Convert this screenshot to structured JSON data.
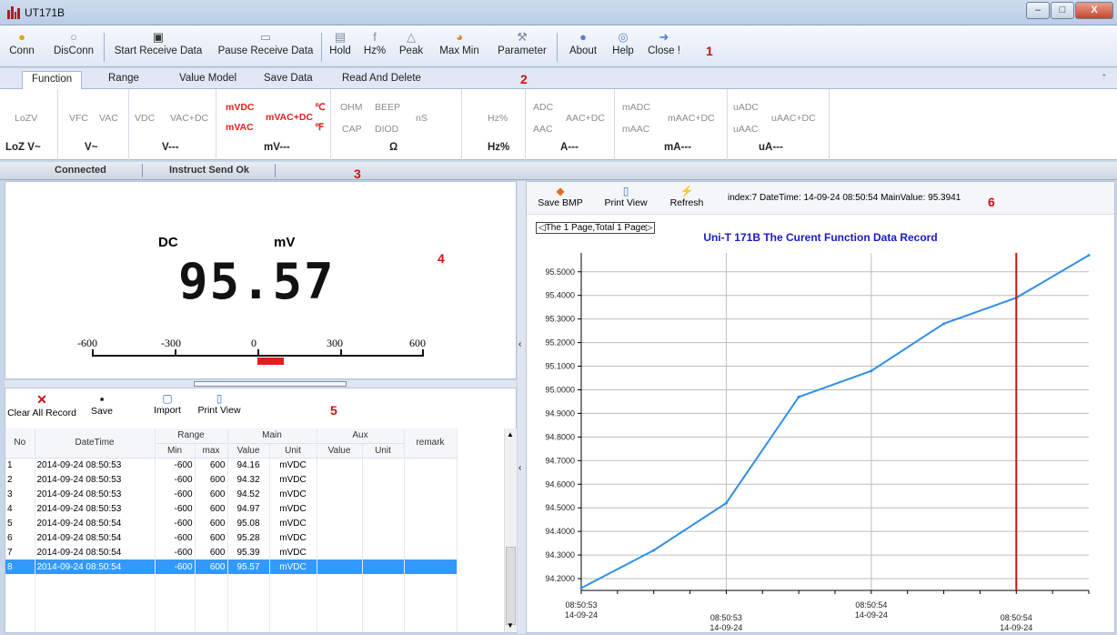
{
  "window": {
    "title": "UT171B",
    "minimize": "–",
    "maximize": "□",
    "close": "X"
  },
  "toolbar": {
    "items": [
      {
        "label": "Conn",
        "icon": "connect-icon"
      },
      {
        "label": "DisConn",
        "icon": "disconnect-icon"
      },
      {
        "label": "Start Receive Data",
        "icon": "start-icon"
      },
      {
        "label": "Pause Receive Data",
        "icon": "pause-icon"
      },
      {
        "label": "Hold",
        "icon": "hold-icon"
      },
      {
        "label": "Hz%",
        "icon": "hz-icon"
      },
      {
        "label": "Peak",
        "icon": "peak-icon"
      },
      {
        "label": "Max Min",
        "icon": "maxmin-icon"
      },
      {
        "label": "Parameter",
        "icon": "parameter-icon"
      },
      {
        "label": "About",
        "icon": "about-icon"
      },
      {
        "label": "Help",
        "icon": "help-icon"
      },
      {
        "label": "Close !",
        "icon": "close-app-icon"
      }
    ]
  },
  "markers": {
    "m1": "1",
    "m2": "2",
    "m3": "3",
    "m4": "4",
    "m5": "5",
    "m6": "6"
  },
  "tabs": [
    "Function",
    "Range",
    "Value Model",
    "Save Data",
    "Read And Delete"
  ],
  "functions": {
    "loz": {
      "top": "LoZV",
      "bottom": "LoZ V~"
    },
    "v": {
      "a": "VFC",
      "b": "VAC",
      "bottom": "V~"
    },
    "vdc": {
      "a": "VDC",
      "b": "VAC+DC",
      "bottom": "V---"
    },
    "mv": {
      "a": "mVDC",
      "b": "mVAC",
      "c": "mVAC+DC",
      "d": "℃",
      "e": "℉",
      "bottom": "mV---"
    },
    "ohm": {
      "a": "OHM",
      "b": "BEEP",
      "c": "CAP",
      "d": "DIOD",
      "e": "nS",
      "bottom": "Ω"
    },
    "hz": {
      "a": "Hz%",
      "bottom": "Hz%"
    },
    "a": {
      "a": "ADC",
      "b": "AAC",
      "c": "AAC+DC",
      "bottom": "A---"
    },
    "ma": {
      "a": "mADC",
      "b": "mAAC",
      "c": "mAAC+DC",
      "bottom": "mA---"
    },
    "ua": {
      "a": "uADC",
      "b": "uAAC",
      "c": "uAAC+DC",
      "bottom": "uA---"
    }
  },
  "status": {
    "conn": "Connected",
    "instr": "Instruct Send Ok"
  },
  "meter": {
    "mode": "DC",
    "unit": "mV",
    "value": "95.57",
    "scale": [
      "-600",
      "-300",
      "0",
      "300",
      "600"
    ],
    "bar_fraction": 0.08
  },
  "records_toolbar": {
    "clear": "Clear All Record",
    "save": "Save",
    "import": "Import",
    "print": "Print View"
  },
  "table": {
    "headers": {
      "no": "No",
      "datetime": "DateTime",
      "range": "Range",
      "main": "Main",
      "aux": "Aux",
      "remark": "remark",
      "min": "Min",
      "max": "max",
      "value": "Value",
      "unit": "Unit",
      "aux_value": "Value",
      "aux_unit": "Unit"
    },
    "rows": [
      [
        "1",
        "2014-09-24 08:50:53",
        "-600",
        "600",
        "94.16",
        "mVDC"
      ],
      [
        "2",
        "2014-09-24 08:50:53",
        "-600",
        "600",
        "94.32",
        "mVDC"
      ],
      [
        "3",
        "2014-09-24 08:50:53",
        "-600",
        "600",
        "94.52",
        "mVDC"
      ],
      [
        "4",
        "2014-09-24 08:50:53",
        "-600",
        "600",
        "94.97",
        "mVDC"
      ],
      [
        "5",
        "2014-09-24 08:50:54",
        "-600",
        "600",
        "95.08",
        "mVDC"
      ],
      [
        "6",
        "2014-09-24 08:50:54",
        "-600",
        "600",
        "95.28",
        "mVDC"
      ],
      [
        "7",
        "2014-09-24 08:50:54",
        "-600",
        "600",
        "95.39",
        "mVDC"
      ],
      [
        "8",
        "2014-09-24 08:50:54",
        "-600",
        "600",
        "95.57",
        "mVDC"
      ]
    ],
    "selected_row": 7
  },
  "chart_toolbar": {
    "save": "Save BMP",
    "print": "Print View",
    "refresh": "Refresh",
    "info": "index:7 DateTime:  14-09-24 08:50:54  MainValue: 95.3941"
  },
  "chart_nav": "◁The 1 Page,Total 1 Page▷",
  "chart_data": {
    "type": "line",
    "title": "Uni-T 171B The Curent Function Data Record",
    "series": [
      {
        "values": [
          94.16,
          94.32,
          94.52,
          94.97,
          95.08,
          95.28,
          95.39,
          95.57
        ]
      }
    ],
    "x": [
      0,
      1,
      2,
      3,
      4,
      5,
      6,
      7
    ],
    "ylim": [
      94.15,
      95.58
    ],
    "yticks": [
      "95.5000",
      "95.4000",
      "95.3000",
      "95.2000",
      "95.1000",
      "95.0000",
      "94.9000",
      "94.8000",
      "94.7000",
      "94.6000",
      "94.5000",
      "94.4000",
      "94.3000",
      "94.2000"
    ],
    "ytick_values": [
      95.5,
      95.4,
      95.3,
      95.2,
      95.1,
      95.0,
      94.9,
      94.8,
      94.7,
      94.6,
      94.5,
      94.4,
      94.3,
      94.2
    ],
    "xticks": [
      {
        "x": 0,
        "time": "08:50:53",
        "date": "14-09-24",
        "row": 0
      },
      {
        "x": 2,
        "time": "08:50:53",
        "date": "14-09-24",
        "row": 1
      },
      {
        "x": 4,
        "time": "08:50:54",
        "date": "14-09-24",
        "row": 0
      },
      {
        "x": 6,
        "time": "08:50:54",
        "date": "14-09-24",
        "row": 1
      }
    ],
    "cursor_x": 6,
    "grid": true,
    "colors": {
      "line": "#2f8fe8",
      "cursor": "#d01010",
      "title": "#1a1ac8"
    }
  }
}
